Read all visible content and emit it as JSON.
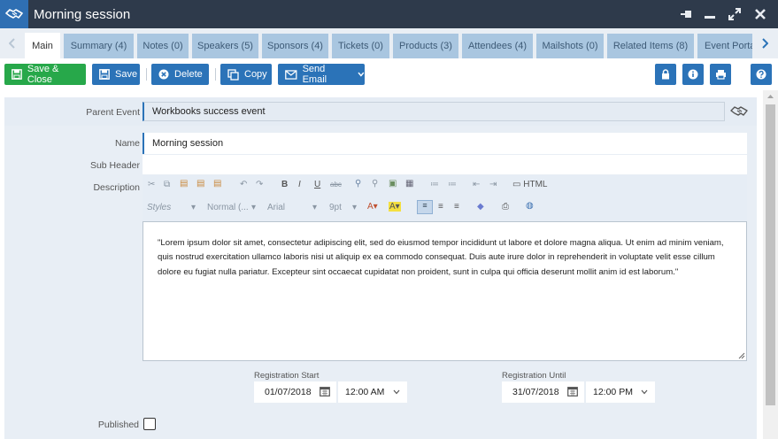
{
  "window": {
    "title": "Morning session",
    "icons": [
      "handshake-icon",
      "pin-icon",
      "minimize-icon",
      "maximize-icon",
      "close-icon"
    ]
  },
  "tabs": [
    {
      "label": "Main",
      "active": true
    },
    {
      "label": "Summary (4)"
    },
    {
      "label": "Notes (0)"
    },
    {
      "label": "Speakers (5)"
    },
    {
      "label": "Sponsors (4)"
    },
    {
      "label": "Tickets (0)"
    },
    {
      "label": "Products (3)"
    },
    {
      "label": "Attendees (4)"
    },
    {
      "label": "Mailshots (0)"
    },
    {
      "label": "Related Items (8)"
    },
    {
      "label": "Event Porta"
    }
  ],
  "toolbar": {
    "save_close": "Save & Close",
    "save": "Save",
    "delete": "Delete",
    "copy": "Copy",
    "send_email": "Send Email",
    "accent_green": "#27a84a",
    "accent_blue": "#2b73b8"
  },
  "form": {
    "parent_event_label": "Parent Event",
    "parent_event_value": "Workbooks success event",
    "name_label": "Name",
    "name_value": "Morning session",
    "sub_header_label": "Sub Header",
    "sub_header_value": "",
    "description_label": "Description",
    "description_text": "\"Lorem ipsum dolor sit amet, consectetur adipiscing elit, sed do eiusmod tempor incididunt ut labore et dolore magna aliqua. Ut enim ad minim veniam, quis nostrud exercitation ullamco laboris nisi ut aliquip ex ea commodo consequat. Duis aute irure dolor in reprehenderit in voluptate velit esse cillum dolore eu fugiat nulla pariatur. Excepteur sint occaecat cupidatat non proident, sunt in culpa qui officia deserunt mollit anim id est laborum.\"",
    "reg_start_label": "Registration Start",
    "reg_start_date": "01/07/2018",
    "reg_start_time": "12:00 AM",
    "reg_until_label": "Registration Until",
    "reg_until_date": "31/07/2018",
    "reg_until_time": "12:00 PM",
    "published_label": "Published",
    "published": false
  },
  "editor": {
    "styles": "Styles",
    "format": "Normal (...",
    "font": "Arial",
    "size": "9pt",
    "html": "HTML"
  }
}
